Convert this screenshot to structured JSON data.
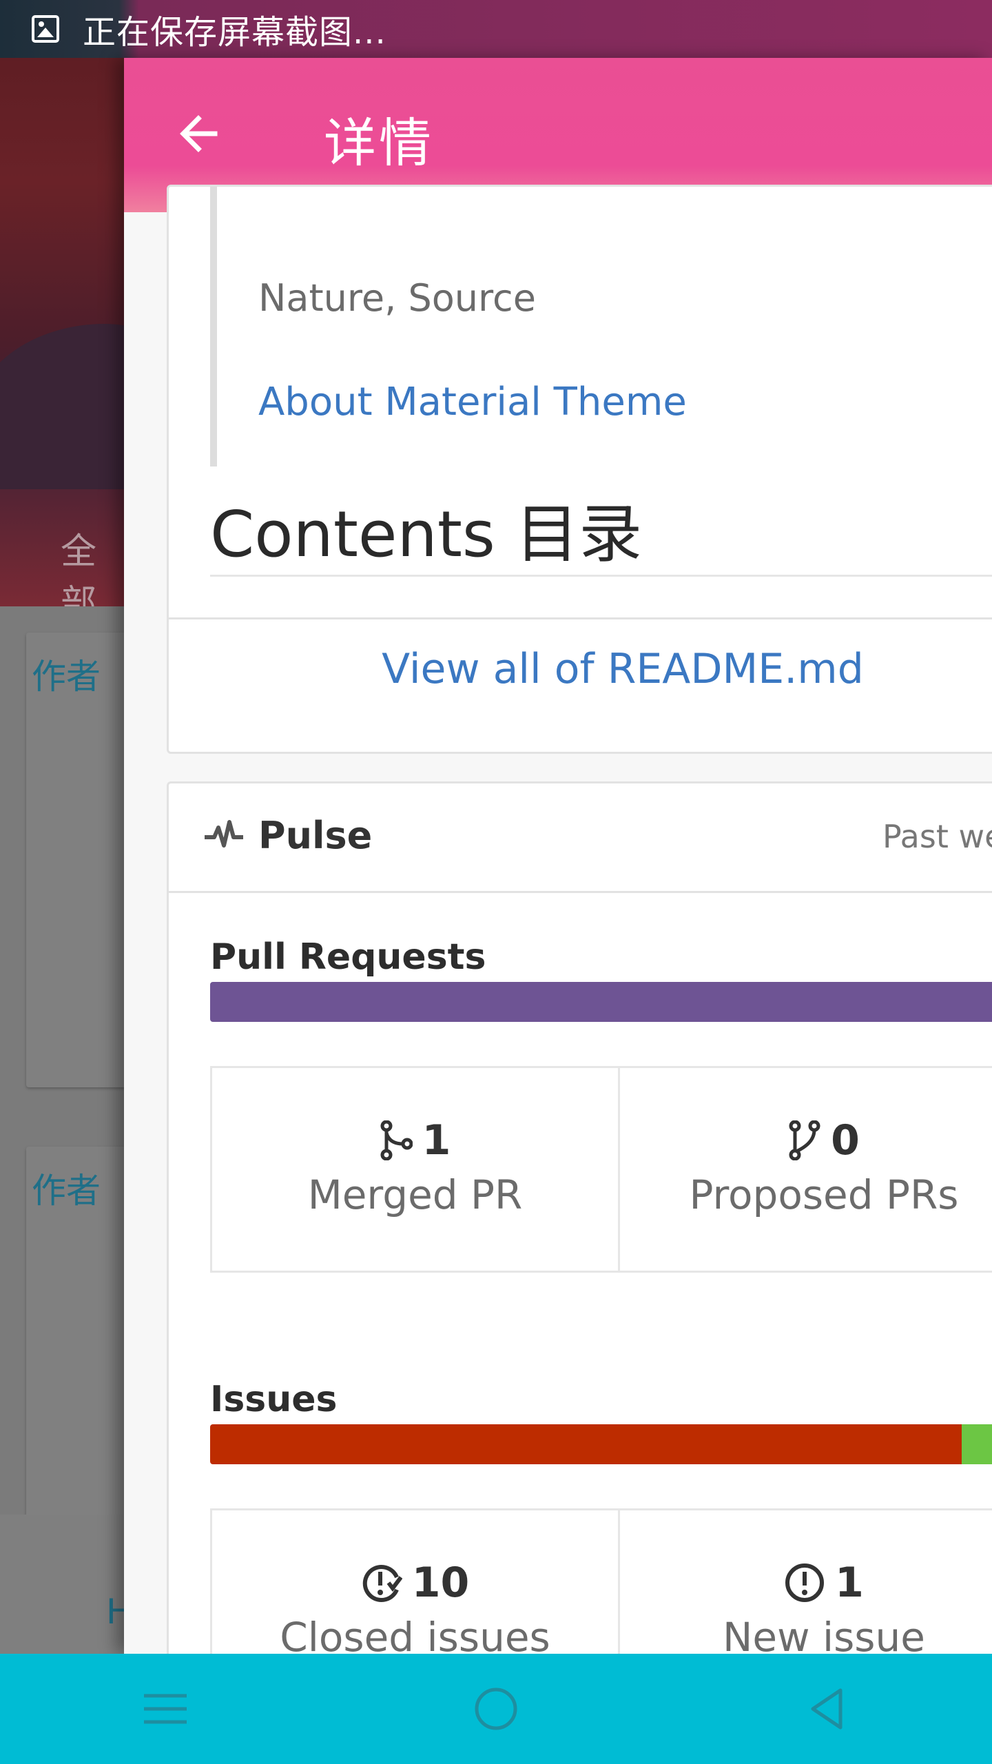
{
  "status_bar": {
    "text": "正在保存屏幕截图..."
  },
  "background": {
    "tab_label": "全部",
    "card_author_label_1": "作者",
    "card_author_label_2": "作者",
    "bottom_letter": "H"
  },
  "appbar": {
    "title": "详情"
  },
  "readme": {
    "quote_line": "Nature, Source",
    "quote_link": "About Material Theme",
    "contents_heading": "Contents 目录",
    "view_all": "View all of README.md"
  },
  "pulse": {
    "title": "Pulse",
    "period": "Past we",
    "pull_requests": {
      "title": "Pull Requests",
      "bar": [
        {
          "color": "#6e5494",
          "fraction": 1.0
        }
      ],
      "stats": [
        {
          "number": "1",
          "label": "Merged PR",
          "icon": "git-merge-icon"
        },
        {
          "number": "0",
          "label": "Proposed PRs",
          "icon": "git-pull-request-icon"
        }
      ]
    },
    "issues": {
      "title": "Issues",
      "bar": [
        {
          "color": "#bd2c00",
          "fraction": 0.909
        },
        {
          "color": "#6cc644",
          "fraction": 0.091
        }
      ],
      "stats": [
        {
          "number": "10",
          "label": "Closed issues",
          "icon": "issue-closed-icon"
        },
        {
          "number": "1",
          "label": "New issue",
          "icon": "issue-opened-icon"
        }
      ]
    }
  },
  "nav_bar": {
    "buttons": [
      "menu",
      "home",
      "back"
    ]
  }
}
